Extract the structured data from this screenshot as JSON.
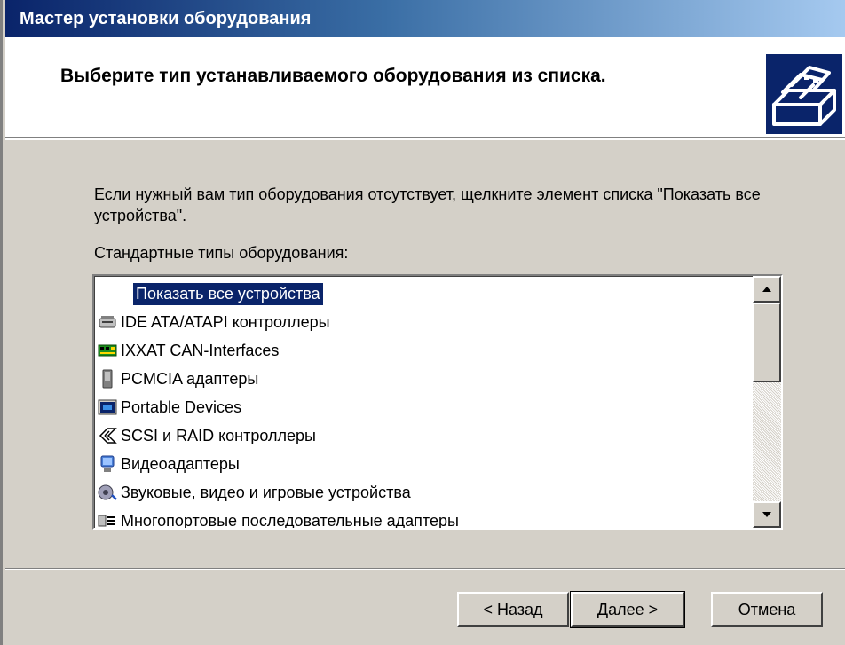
{
  "window": {
    "title": "Мастер установки оборудования"
  },
  "header": {
    "title": "Выберите тип устанавливаемого оборудования из списка.",
    "icon": "hardware-install-icon"
  },
  "body": {
    "description": "Если нужный вам тип оборудования отсутствует, щелкните элемент списка \"Показать все устройства\".",
    "list_label": "Стандартные типы оборудования:"
  },
  "list": {
    "items": [
      {
        "label": "Показать все устройства",
        "icon": "none",
        "selected": true
      },
      {
        "label": "IDE ATA/ATAPI контроллеры",
        "icon": "ide-controller-icon"
      },
      {
        "label": "IXXAT CAN-Interfaces",
        "icon": "can-interface-icon"
      },
      {
        "label": "PCMCIA адаптеры",
        "icon": "pcmcia-icon"
      },
      {
        "label": "Portable Devices",
        "icon": "portable-device-icon"
      },
      {
        "label": "SCSI и RAID контроллеры",
        "icon": "scsi-icon"
      },
      {
        "label": "Видеоадаптеры",
        "icon": "video-adapter-icon"
      },
      {
        "label": "Звуковые, видео и игровые устройства",
        "icon": "sound-icon"
      },
      {
        "label": "Многопортовые последовательные адаптеры",
        "icon": "multiport-icon"
      }
    ]
  },
  "buttons": {
    "back": "< Назад",
    "next": "Далее >",
    "cancel": "Отмена"
  },
  "colors": {
    "title_bar": "#0a246a",
    "selection": "#0a246a",
    "face": "#d4d0c8"
  }
}
